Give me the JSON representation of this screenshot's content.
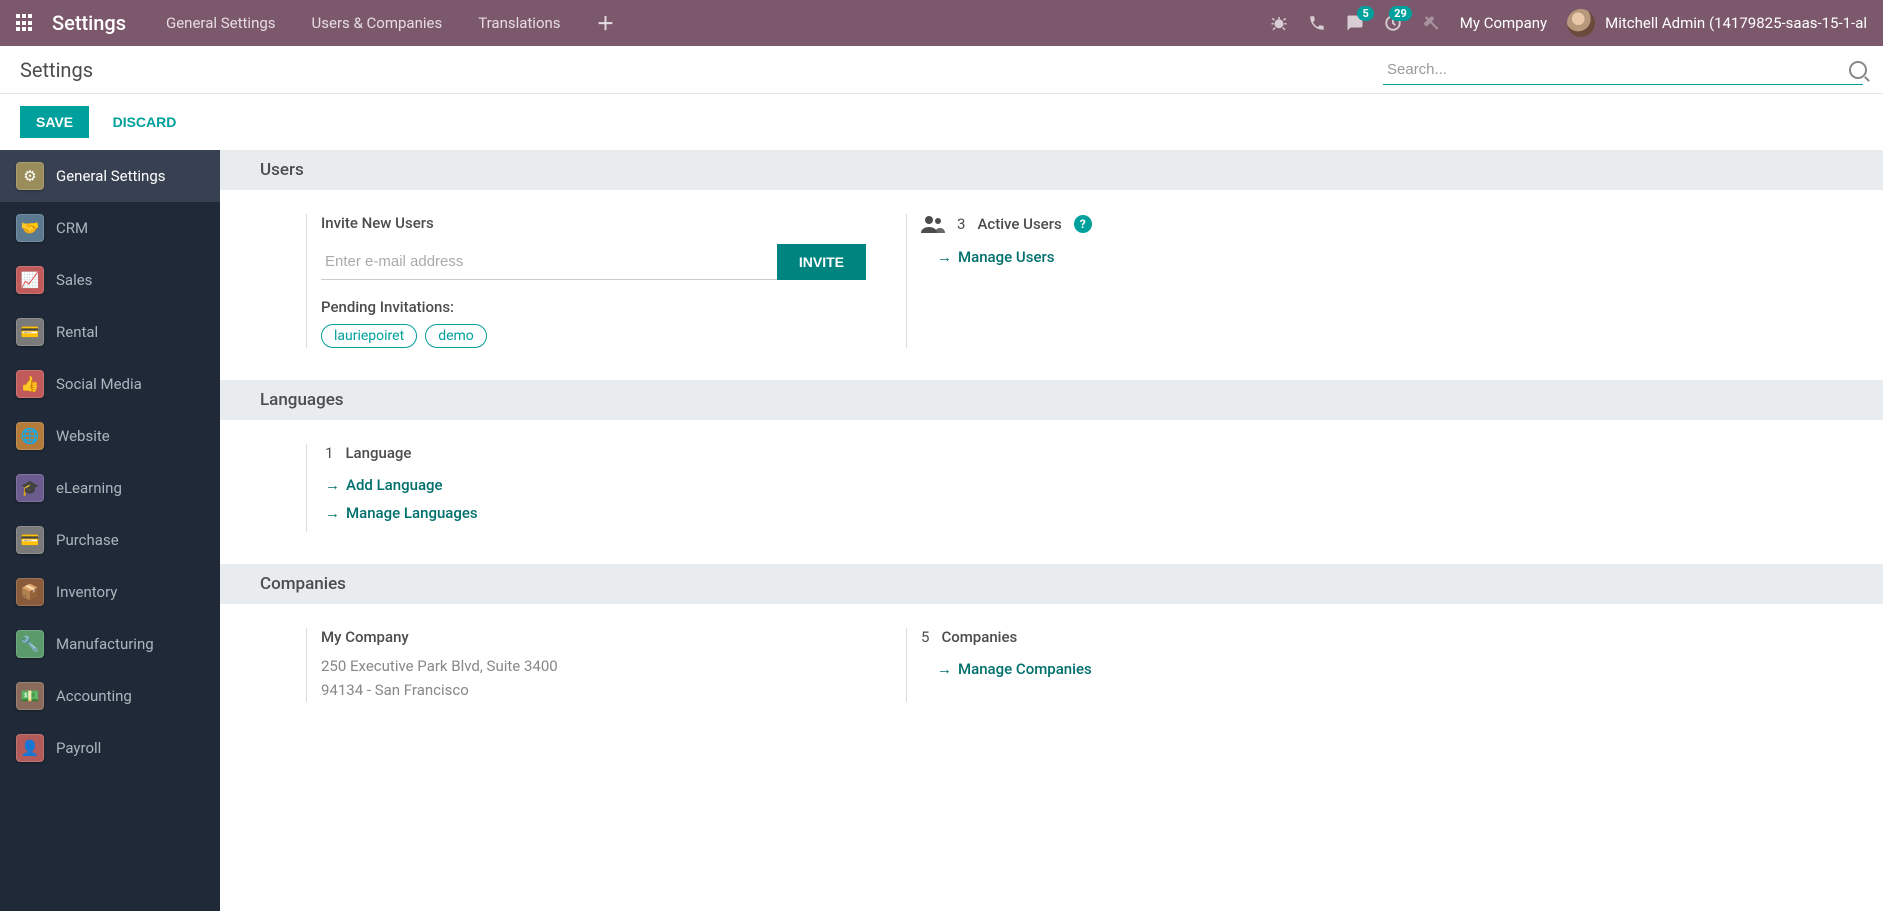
{
  "topnav": {
    "app_title": "Settings",
    "menu": [
      "General Settings",
      "Users & Companies",
      "Translations"
    ],
    "messages_badge": "5",
    "activities_badge": "29",
    "company": "My Company",
    "user": "Mitchell Admin (14179825-saas-15-1-al"
  },
  "breadcrumb": {
    "title": "Settings"
  },
  "search": {
    "placeholder": "Search..."
  },
  "actions": {
    "save": "SAVE",
    "discard": "DISCARD"
  },
  "sidebar": {
    "items": [
      {
        "label": "General Settings",
        "bg": "#9a8d5b",
        "glyph": "⚙"
      },
      {
        "label": "CRM",
        "bg": "#5b7a8f",
        "glyph": "🤝"
      },
      {
        "label": "Sales",
        "bg": "#c15b5b",
        "glyph": "📈"
      },
      {
        "label": "Rental",
        "bg": "#7a7a7a",
        "glyph": "💳"
      },
      {
        "label": "Social Media",
        "bg": "#c15b5b",
        "glyph": "👍"
      },
      {
        "label": "Website",
        "bg": "#b37a3a",
        "glyph": "🌐"
      },
      {
        "label": "eLearning",
        "bg": "#6b5b8f",
        "glyph": "🎓"
      },
      {
        "label": "Purchase",
        "bg": "#7a7a7a",
        "glyph": "💳"
      },
      {
        "label": "Inventory",
        "bg": "#8a5b3a",
        "glyph": "📦"
      },
      {
        "label": "Manufacturing",
        "bg": "#5b9a6b",
        "glyph": "🔧"
      },
      {
        "label": "Accounting",
        "bg": "#8a6b5b",
        "glyph": "💵"
      },
      {
        "label": "Payroll",
        "bg": "#b35b5b",
        "glyph": "👤"
      }
    ]
  },
  "sections": {
    "users": {
      "title": "Users",
      "invite_label": "Invite New Users",
      "email_placeholder": "Enter e-mail address",
      "invite_btn": "INVITE",
      "pending_label": "Pending Invitations:",
      "pending": [
        "lauriepoiret",
        "demo"
      ],
      "active_count": "3",
      "active_label": "Active Users",
      "manage_link": "Manage Users"
    },
    "languages": {
      "title": "Languages",
      "count": "1",
      "count_label": "Language",
      "add_link": "Add Language",
      "manage_link": "Manage Languages"
    },
    "companies": {
      "title": "Companies",
      "name": "My Company",
      "addr1": "250 Executive Park Blvd, Suite 3400",
      "addr2": "94134 - San Francisco",
      "count": "5",
      "count_label": "Companies",
      "manage_link": "Manage Companies"
    }
  }
}
